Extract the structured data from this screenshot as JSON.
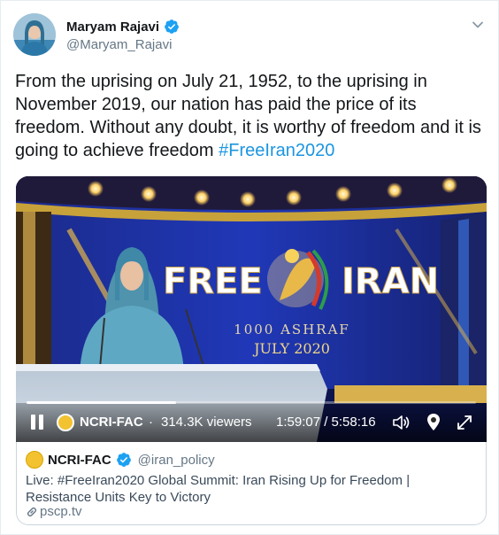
{
  "tweet": {
    "author": {
      "display_name": "Maryam Rajavi",
      "handle": "@Maryam_Rajavi",
      "verified": true,
      "avatar_icon": "profile-photo"
    },
    "text": "From the uprising on July 21, 1952, to the uprising in November 2019, our nation has paid the price of its freedom. Without any doubt, it is worthy of freedom and it is going to achieve freedom ",
    "hashtag": "#FreeIran2020",
    "menu_icon": "chevron-down-icon"
  },
  "video": {
    "scene": {
      "banner_left": "FREE",
      "banner_right": "IRAN",
      "subtitle": "1000 ASHRAF",
      "date": "JULY 2020"
    },
    "player": {
      "state_icon": "pause-icon",
      "channel": "NCRI-FAC",
      "separator": "·",
      "viewers": "314.3K viewers",
      "time": "1:59:07 / 5:58:16",
      "progress": 0.332
    }
  },
  "link_card": {
    "name": "NCRI-FAC",
    "handle": "@iran_policy",
    "verified": true,
    "description": "Live: #FreeIran2020 Global Summit: Iran Rising Up for Freedom | Resistance Units Key to Victory",
    "domain": "pscp.tv"
  },
  "colors": {
    "link_blue": "#1b95e0",
    "verified_blue": "#1da1f2",
    "text": "#14171a",
    "muted": "#657786"
  }
}
